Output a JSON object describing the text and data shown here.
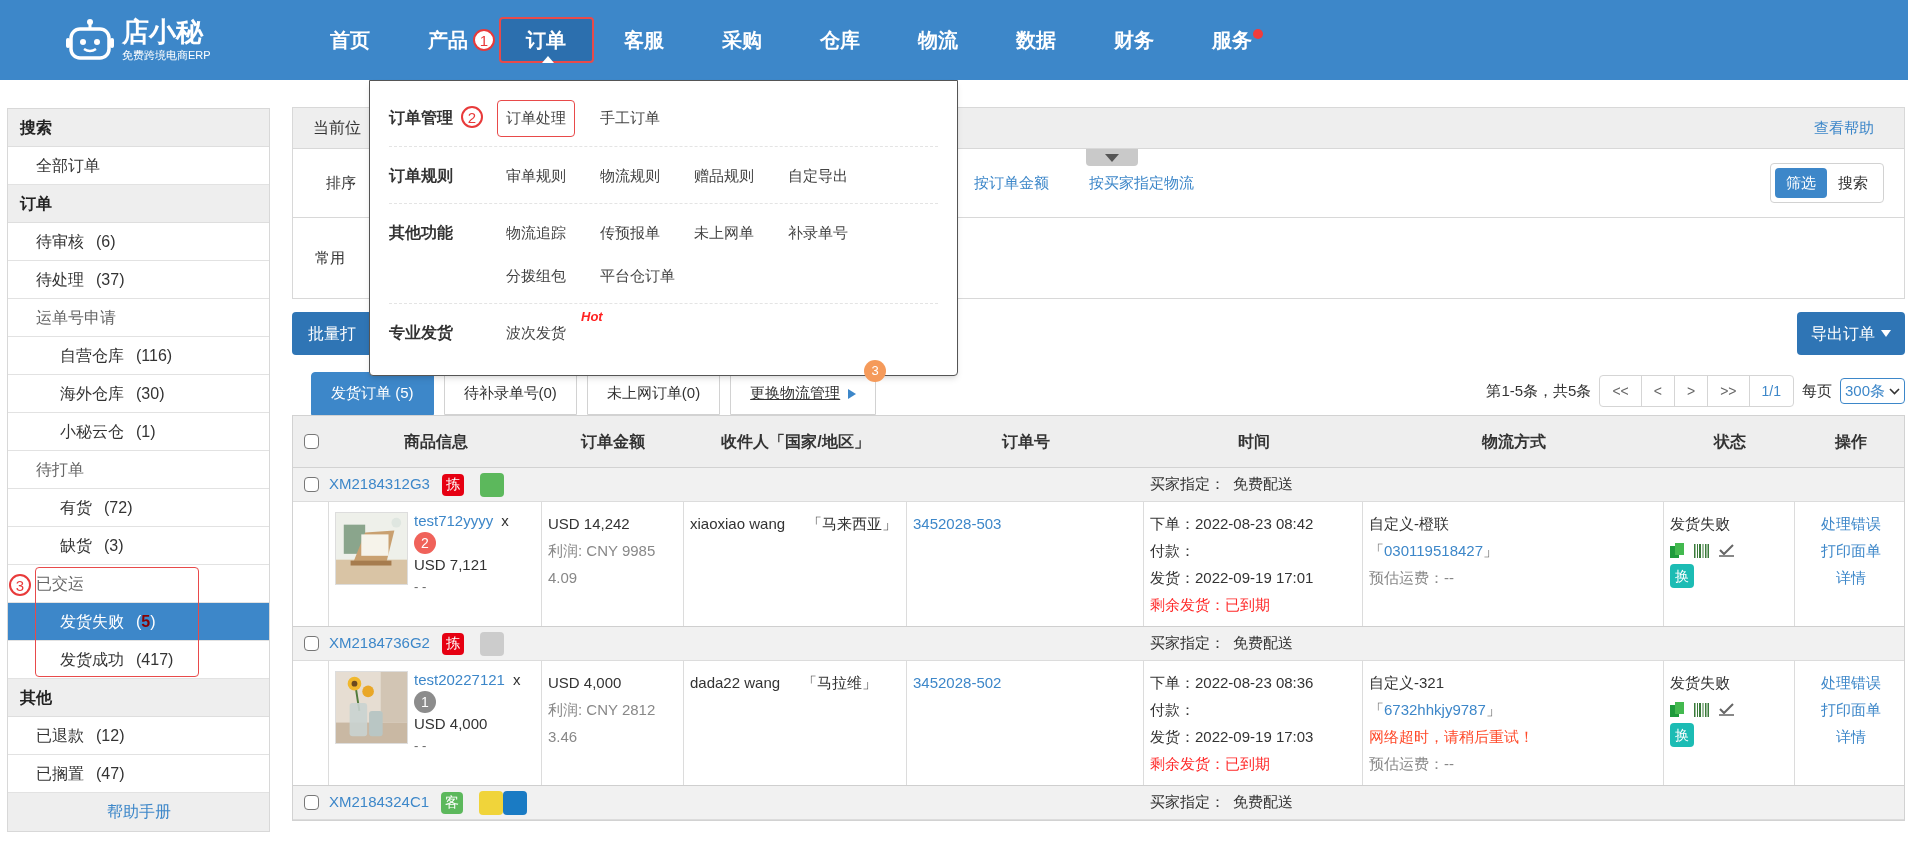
{
  "header": {
    "logo": {
      "name": "店小秘",
      "tagline": "免费跨境电商ERP"
    },
    "nav": [
      {
        "label": "首页",
        "selected": false,
        "boxed": false,
        "dot": false
      },
      {
        "label": "产品",
        "selected": false,
        "boxed": false,
        "dot": false,
        "annotation": "1"
      },
      {
        "label": "订单",
        "selected": true,
        "boxed": true,
        "dot": false
      },
      {
        "label": "客服",
        "selected": false,
        "boxed": false,
        "dot": false
      },
      {
        "label": "采购",
        "selected": false,
        "boxed": false,
        "dot": false
      },
      {
        "label": "仓库",
        "selected": false,
        "boxed": false,
        "dot": false
      },
      {
        "label": "物流",
        "selected": false,
        "boxed": false,
        "dot": false
      },
      {
        "label": "数据",
        "selected": false,
        "boxed": false,
        "dot": false
      },
      {
        "label": "财务",
        "selected": false,
        "boxed": false,
        "dot": false
      },
      {
        "label": "服务",
        "selected": false,
        "boxed": false,
        "dot": true
      }
    ]
  },
  "dropdown_menu": {
    "sections": [
      {
        "title": "订单管理",
        "annotation": "2",
        "items": [
          {
            "label": "订单处理",
            "boxed": true
          },
          {
            "label": "手工订单",
            "boxed": false
          }
        ]
      },
      {
        "title": "订单规则",
        "items": [
          {
            "label": "审单规则",
            "boxed": false
          },
          {
            "label": "物流规则",
            "boxed": false
          },
          {
            "label": "赠品规则",
            "boxed": false
          },
          {
            "label": "自定导出",
            "boxed": false
          }
        ]
      },
      {
        "title": "其他功能",
        "items": [
          {
            "label": "物流追踪",
            "boxed": false
          },
          {
            "label": "传预报单",
            "boxed": false
          },
          {
            "label": "未上网单",
            "boxed": false
          },
          {
            "label": "补录单号",
            "boxed": false
          },
          {
            "label": "分拨组包",
            "boxed": false
          },
          {
            "label": "平台仓订单",
            "boxed": false
          }
        ]
      },
      {
        "title": "专业发货",
        "items": [
          {
            "label": "波次发货",
            "boxed": false,
            "badge": "Hot"
          }
        ]
      }
    ]
  },
  "sidebar": {
    "sections": [
      {
        "title": "搜索",
        "items": [
          {
            "kind": "item",
            "label": "全部订单",
            "selected": false
          }
        ]
      },
      {
        "title": "订单",
        "items": [
          {
            "kind": "item",
            "label": "待审核",
            "count": "(6)",
            "selected": false
          },
          {
            "kind": "item",
            "label": "待处理",
            "count": "(37)",
            "selected": false
          },
          {
            "kind": "group",
            "label": "运单号申请",
            "boxed": false,
            "children": [
              {
                "label": "自营仓库",
                "count": "(116)",
                "selected": false
              },
              {
                "label": "海外仓库",
                "count": "(30)",
                "selected": false
              },
              {
                "label": "小秘云仓",
                "count": "(1)",
                "selected": false
              }
            ]
          },
          {
            "kind": "group",
            "label": "待打单",
            "boxed": false,
            "children": [
              {
                "label": "有货",
                "count": "(72)",
                "selected": false
              },
              {
                "label": "缺货",
                "count": "(3)",
                "selected": false
              }
            ]
          },
          {
            "kind": "group",
            "label": "已交运",
            "boxed": true,
            "annotation": "3",
            "children": [
              {
                "label": "发货失败",
                "count": "(**5**)",
                "selected": true
              },
              {
                "label": "发货成功",
                "count": "(417)",
                "selected": false
              }
            ]
          }
        ]
      },
      {
        "title": "其他",
        "items": [
          {
            "kind": "item",
            "label": "已退款",
            "count": "(12)",
            "selected": false
          },
          {
            "kind": "item",
            "label": "已搁置",
            "count": "(47)",
            "selected": false
          }
        ]
      }
    ],
    "footer": "帮助手册"
  },
  "breadcrumb": {
    "label": "当前位",
    "help": "查看帮助"
  },
  "filters": {
    "sort_label": "排序",
    "sort_options": [
      "按订单金额",
      "按买家指定物流"
    ],
    "modes": [
      {
        "label": "筛选",
        "selected": true
      },
      {
        "label": "搜索",
        "selected": false
      }
    ],
    "common_label": "常用"
  },
  "actions": {
    "batch": "批量打",
    "export": "导出订单"
  },
  "tabs": [
    {
      "kind": "tab",
      "label": "发货订单 (5)",
      "selected": true
    },
    {
      "kind": "tab",
      "label": "待补录单号(0)",
      "selected": false
    },
    {
      "kind": "tab",
      "label": "未上网订单(0)",
      "selected": false
    },
    {
      "kind": "link",
      "label": "更换物流管理",
      "selected": false,
      "badge": "3"
    }
  ],
  "pagination": {
    "summary": "第1-5条，共5条",
    "buttons": [
      "<<",
      "<",
      ">",
      ">>",
      "1/1"
    ],
    "per_page_label": "每页",
    "per_page": "300条"
  },
  "table": {
    "all_checked": false,
    "columns": [
      "商品信息",
      "订单金额",
      "收件人「国家/地区」",
      "订单号",
      "时间",
      "物流方式",
      "状态",
      "操作"
    ],
    "orders": [
      {
        "id": "XM2184312G3",
        "tags": [
          {
            "text": "拣",
            "color": "#e60012"
          }
        ],
        "swatches": [
          {
            "color": "#5cb85c"
          }
        ],
        "note": "买家指定：  免费配送",
        "checked": false,
        "item": {
          "kind": "picture",
          "product": "test712yyyy",
          "times": "x",
          "qty": {
            "text": "2",
            "color": "#f0625a"
          },
          "price": "USD 7,121",
          "extra": "- -"
        },
        "amount": "USD 14,242",
        "profit": "利润: CNY 99854.09",
        "recipient": "xiaoxiao wang",
        "country": "「马来西亚」",
        "order_no": "3452028-503",
        "times": [
          {
            "text": "下单：2022-08-23 08:42",
            "kind": "normal"
          },
          {
            "text": "付款：",
            "kind": "normal"
          },
          {
            "text": "发货：2022-09-19 17:01",
            "kind": "normal"
          },
          {
            "text": "剩余发货：已到期",
            "kind": "alert"
          }
        ],
        "logistics": {
          "name": "自定义-橙联",
          "open": "「",
          "tracking": "030119518427",
          "close": "」",
          "fee": "预估运费：--"
        },
        "status": "发货失败",
        "swap": "换",
        "ops": [
          "处理错误",
          "打印面单",
          "详情"
        ]
      },
      {
        "id": "XM2184736G2",
        "tags": [
          {
            "text": "拣",
            "color": "#e60012"
          }
        ],
        "swatches": [
          {
            "color": "#cccccc"
          }
        ],
        "note": "买家指定：  免费配送",
        "checked": false,
        "item": {
          "kind": "picture",
          "product": "test20227121",
          "times": "x",
          "qty": {
            "text": "1",
            "color": "#8c8c8c"
          },
          "price": "USD 4,000",
          "extra": "- -"
        },
        "amount": "USD 4,000",
        "profit": "利润: CNY 28123.46",
        "recipient": "dada22 wang",
        "country": "「马拉维」",
        "order_no": "3452028-502",
        "times": [
          {
            "text": "下单：2022-08-23 08:36",
            "kind": "normal"
          },
          {
            "text": "付款：",
            "kind": "normal"
          },
          {
            "text": "发货：2022-09-19 17:03",
            "kind": "normal"
          },
          {
            "text": "剩余发货：已到期",
            "kind": "alert"
          }
        ],
        "logistics": {
          "name": "自定义-321",
          "open": "「",
          "tracking": "6732hhkjy9787",
          "close": "」",
          "error": "网络超时，请稍后重试！",
          "fee": "预估运费：--"
        },
        "status": "发货失败",
        "swap": "换",
        "ops": [
          "处理错误",
          "打印面单",
          "详情"
        ]
      },
      {
        "id": "XM2184324C1",
        "tags": [
          {
            "text": "客",
            "color": "#5cb85c"
          }
        ],
        "swatches": [
          {
            "color": "#f0d43a"
          },
          {
            "color": "#1a7bc4"
          }
        ],
        "checked": false,
        "note": "买家指定：  免费配送"
      }
    ]
  }
}
